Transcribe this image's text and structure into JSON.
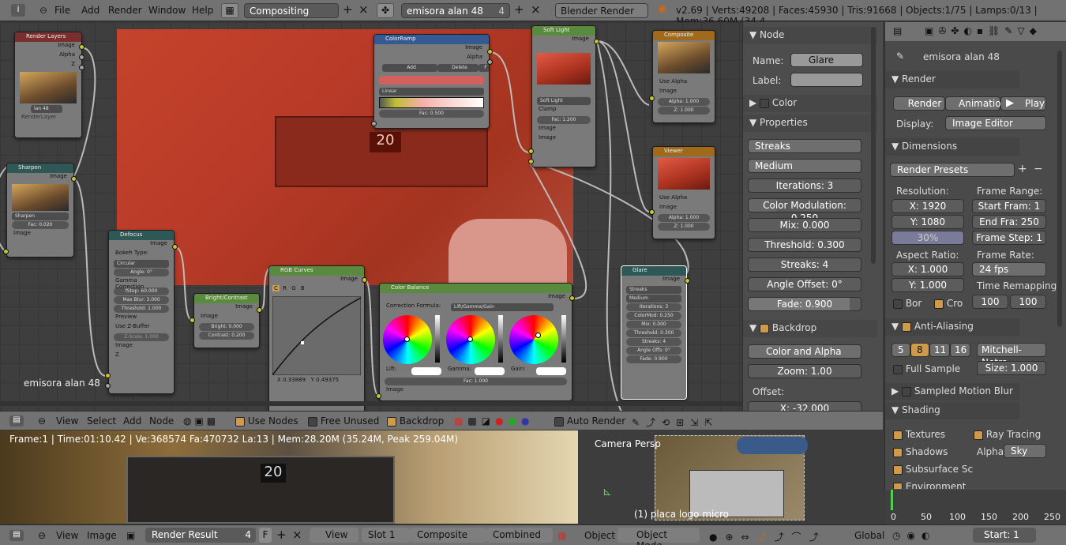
{
  "top": {
    "menus": [
      "File",
      "Add",
      "Render",
      "Window",
      "Help"
    ],
    "screen": "Compositing",
    "scene": "emisora alan 48",
    "scene_num": "4",
    "engine": "Blender Render",
    "stats": "v2.69 | Verts:49208 | Faces:45930 | Tris:91668 | Objects:1/75 | Lamps:0/13 | Mem:36.60M (34.4"
  },
  "nodes": {
    "render_layers": {
      "title": "Render Layers",
      "outs": [
        "Image",
        "Alpha",
        "Z"
      ],
      "layer": "lan 48",
      "layer_num": "4",
      "renderlayer": "RenderLayer"
    },
    "sharpen": {
      "title": "Sharpen",
      "out": "Image",
      "mode": "Sharpen",
      "fac": "Fac: 0.020",
      "in": "Image"
    },
    "defocus": {
      "title": "Defocus",
      "out": "Image",
      "bokeh": "Bokeh Type:",
      "circular": "Circular",
      "angle": "Angle: 0°",
      "gamma": "Gamma Correction",
      "fstop": "fStop: 60.000",
      "maxblur": "Max Blur: 3.000",
      "threshold": "Threshold: 1.000",
      "preview": "Preview",
      "zbuf": "Use Z-Buffer",
      "zscale": "Z-Scale: 1.000",
      "in1": "Image",
      "in2": "Z"
    },
    "bright": {
      "title": "Bright/Contrast",
      "out": "Image",
      "in": "Image",
      "bright": "Bright: 0.000",
      "contrast": "Contrast: 0.200"
    },
    "curves": {
      "title": "RGB Curves",
      "out": "Image",
      "tabs": [
        "C",
        "R",
        "G",
        "B"
      ],
      "x": "X 0.33889",
      "y": "Y 0.49375"
    },
    "colorbalance": {
      "title": "Color Balance",
      "out": "Image",
      "formula": "Correction Formula:",
      "mode": "Lift/Gamma/Gain",
      "lift": "Lift:",
      "gamma": "Gamma:",
      "gain": "Gain:",
      "fac": "Fac: 1.000",
      "in": "Image"
    },
    "colorramp": {
      "title": "ColorRamp",
      "outs": [
        "Image",
        "Alpha"
      ],
      "add": "Add",
      "delete": "Delete",
      "f": "F",
      "interp": "Linear",
      "fac": "Fac: 0.500"
    },
    "softlight": {
      "title": "Soft Light",
      "out": "Image",
      "mode": "Soft Light",
      "clamp": "Clamp",
      "fac": "Fac: 1.200",
      "in1": "Image",
      "in2": "Image"
    },
    "composite": {
      "title": "Composite",
      "usealpha": "Use Alpha",
      "in": "Image",
      "alpha": "Alpha: 1.000",
      "z": "Z: 1.000"
    },
    "viewer": {
      "title": "Viewer",
      "usealpha": "Use Alpha",
      "in": "Image",
      "alpha": "Alpha: 1.000",
      "z": "Z: 1.000"
    },
    "glare": {
      "title": "Glare",
      "out": "Image",
      "type": "Streaks",
      "quality": "Medium",
      "iter": "Iterations: 3",
      "colmod": "ColorMod: 0.250",
      "mix": "Mix: 0.000",
      "thresh": "Threshold: 0.300",
      "streaks": "Streaks: 4",
      "angle": "Angle Offs: 0°",
      "fade": "Fade: 0.900"
    }
  },
  "editor_label": "emisora alan 48",
  "nodepanel": {
    "node_h": "Node",
    "name_l": "Name:",
    "name_v": "Glare",
    "label_l": "Label:",
    "color_h": "Color",
    "props_h": "Properties",
    "type": "Streaks",
    "quality": "Medium",
    "iterations": "Iterations: 3",
    "colmod": "Color Modulation: 0.250",
    "mix": "Mix: 0.000",
    "threshold": "Threshold: 0.300",
    "streaks": "Streaks: 4",
    "angle": "Angle Offset: 0°",
    "fade": "Fade: 0.900",
    "backdrop_h": "Backdrop",
    "ca": "Color and Alpha",
    "zoom": "Zoom: 1.00",
    "offset": "Offset:",
    "offx": "X: -32.000"
  },
  "nehdr": {
    "menus": [
      "View",
      "Select",
      "Add",
      "Node"
    ],
    "usenodes": "Use Nodes",
    "freeunused": "Free Unused",
    "backdrop": "Backdrop",
    "autorender": "Auto Render"
  },
  "imgview": {
    "status": "Frame:1 | Time:01:10.42 | Ve:368574 Fa:470732 La:13 | Mem:28.20M (35.24M, Peak 259.04M)"
  },
  "view3d": {
    "label": "Camera Persp",
    "object": "(1) placa logo micro"
  },
  "render": {
    "scene": "emisora alan 48",
    "render_h": "Render",
    "render_b": "Render",
    "anim_b": "Animatio",
    "play_b": "Play",
    "display_l": "Display:",
    "display_v": "Image Editor",
    "dim_h": "Dimensions",
    "presets": "Render Presets",
    "res_l": "Resolution:",
    "rx": "X: 1920",
    "ry": "Y: 1080",
    "pct": "30%",
    "fr_l": "Frame Range:",
    "start": "Start Fram: 1",
    "end": "End Fra: 250",
    "step": "Frame Step: 1",
    "asp_l": "Aspect Ratio:",
    "ax": "X: 1.000",
    "ay": "Y: 1.000",
    "rate_l": "Frame Rate:",
    "fps": "24 fps",
    "remap": "Time Remapping:",
    "r1": "100",
    "r2": "100",
    "bor": "Bor",
    "cro": "Cro",
    "aa_h": "Anti-Aliasing",
    "aa": [
      "5",
      "8",
      "11",
      "16"
    ],
    "filter": "Mitchell-Netra",
    "full": "Full Sample",
    "size": "Size: 1.000",
    "smb_h": "Sampled Motion Blur",
    "shading_h": "Shading",
    "textures": "Textures",
    "raytracing": "Ray Tracing",
    "shadows": "Shadows",
    "alpha_l": "Alpha:",
    "alpha_v": "Sky",
    "sss": "Subsurface Sc",
    "env": "Environment"
  },
  "timeline": {
    "ticks": [
      "0",
      "50",
      "100",
      "150",
      "200",
      "250"
    ],
    "start": "Start: 1"
  },
  "bottom": {
    "view": "View",
    "image": "Image",
    "result": "Render Result",
    "num": "4",
    "f": "F",
    "view2": "View",
    "slot": "Slot 1",
    "composite": "Composite",
    "combined": "Combined",
    "object": "Object",
    "mode": "Object Mode",
    "global": "Global"
  }
}
